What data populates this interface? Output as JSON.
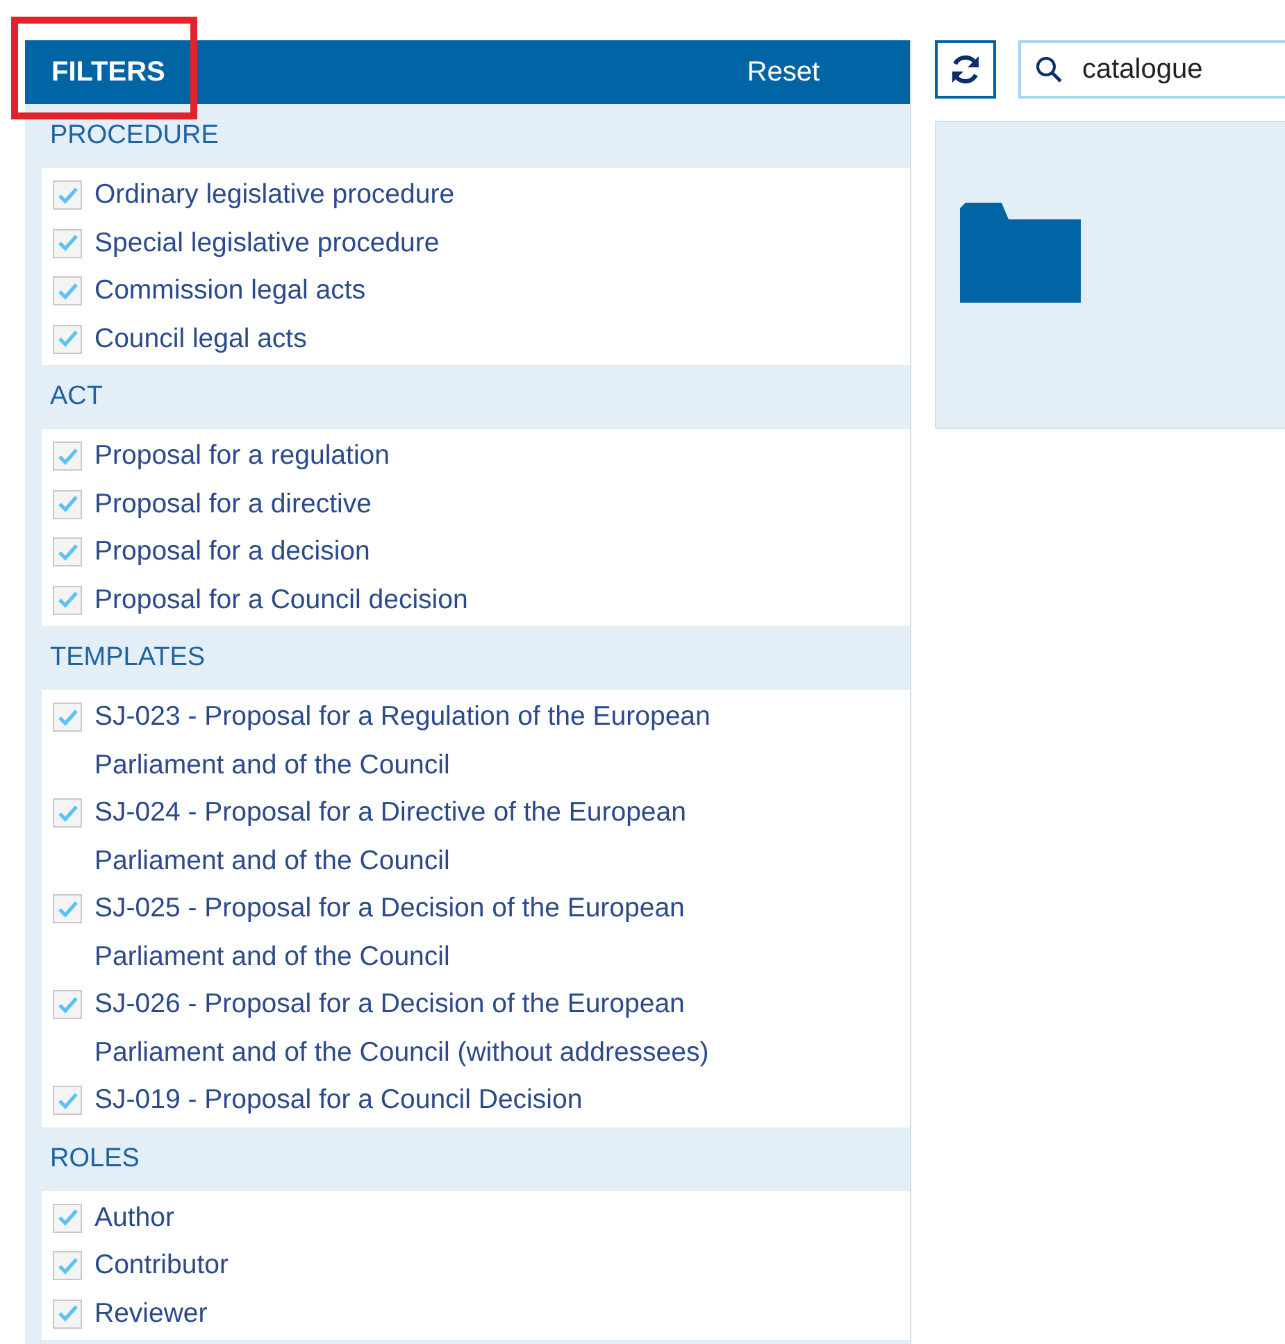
{
  "filters": {
    "title": "FILTERS",
    "highlighted": true,
    "reset": "Reset",
    "sections": [
      {
        "heading": "PROCEDURE",
        "options": [
          {
            "label": "Ordinary legislative procedure",
            "checked": true
          },
          {
            "label": "Special legislative procedure",
            "checked": true
          },
          {
            "label": "Commission legal acts",
            "checked": true
          },
          {
            "label": "Council legal acts",
            "checked": true
          }
        ]
      },
      {
        "heading": "ACT",
        "options": [
          {
            "label": "Proposal for a regulation",
            "checked": true
          },
          {
            "label": "Proposal for a directive",
            "checked": true
          },
          {
            "label": "Proposal for a decision",
            "checked": true
          },
          {
            "label": "Proposal for a Council decision",
            "checked": true
          }
        ]
      },
      {
        "heading": "TEMPLATES",
        "options": [
          {
            "label": "SJ-023 - Proposal for a Regulation of the European Parliament and of the Council",
            "checked": true
          },
          {
            "label": "SJ-024 - Proposal for a Directive of the European Parliament and of the Council",
            "checked": true
          },
          {
            "label": "SJ-025 - Proposal for a Decision of the European Parliament and of the Council",
            "checked": true
          },
          {
            "label": "SJ-026 - Proposal for a Decision of the European Parliament and of the Council (without addressees)",
            "checked": true
          },
          {
            "label": "SJ-019 - Proposal for a Council Decision",
            "checked": true
          }
        ]
      },
      {
        "heading": "ROLES",
        "options": [
          {
            "label": "Author",
            "checked": true
          },
          {
            "label": "Contributor",
            "checked": true
          },
          {
            "label": "Reviewer",
            "checked": true
          }
        ]
      }
    ]
  },
  "search": {
    "value": "catalogue"
  }
}
